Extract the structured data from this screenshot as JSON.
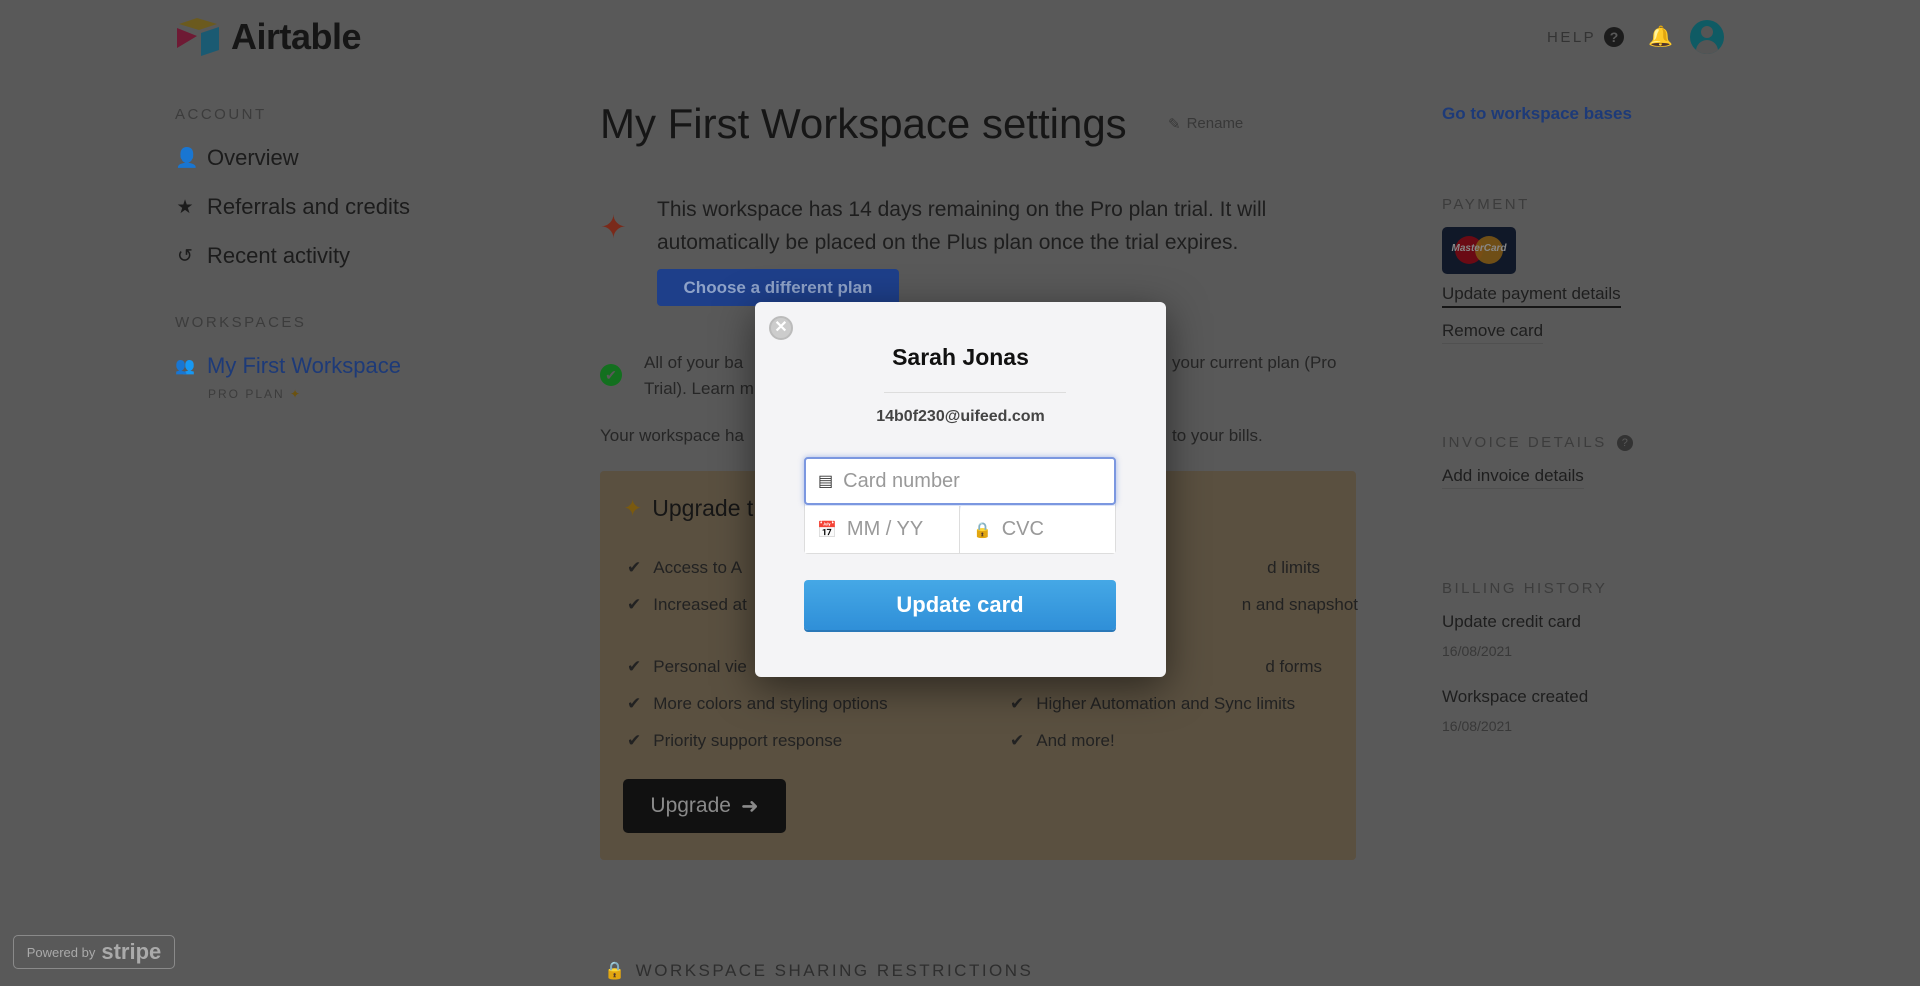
{
  "header": {
    "logo": "Airtable",
    "help": "HELP",
    "icons": [
      "help-icon",
      "bell-icon",
      "avatar-icon"
    ]
  },
  "sidebar": {
    "account_heading": "ACCOUNT",
    "items": [
      {
        "label": "Overview",
        "icon": "user-icon"
      },
      {
        "label": "Referrals and credits",
        "icon": "star-icon"
      },
      {
        "label": "Recent activity",
        "icon": "history-icon"
      }
    ],
    "workspaces_heading": "WORKSPACES",
    "workspace": {
      "label": "My First Workspace",
      "plan": "PRO PLAN"
    }
  },
  "main": {
    "title": "My First Workspace settings",
    "rename": "Rename",
    "trial_notice": [
      "This workspace has 14 days remaining on the Pro plan trial. It will",
      "automatically be placed on the Plus plan once the trial expires."
    ],
    "choose_plan": "Choose a different plan",
    "bases_left": [
      "All of your ba",
      "Trial). Learn m"
    ],
    "bases_right": "your current plan (Pro",
    "workspace_left": "Your workspace ha",
    "workspace_right": "to your bills.",
    "upgrade": {
      "title": "Upgrade t",
      "features_left": [
        "Access to A",
        "Increased at",
        "Personal vie",
        "More colors and styling options",
        "Priority support response"
      ],
      "features_right": [
        "d limits",
        "n and snapshot",
        "d forms",
        "Higher Automation and Sync limits",
        "And more!"
      ],
      "button": "Upgrade",
      "color": "#fbe8bd"
    },
    "sharing_heading": "WORKSPACE SHARING RESTRICTIONS"
  },
  "right": {
    "go_to_bases": "Go to workspace bases",
    "payment_heading": "PAYMENT",
    "card_brand": "MasterCard",
    "update_payment": "Update payment details",
    "remove_card": "Remove card",
    "invoice_heading": "INVOICE DETAILS",
    "add_invoice": "Add invoice details",
    "billing_heading": "BILLING HISTORY",
    "history": [
      {
        "label": "Update credit card",
        "date": "16/08/2021"
      },
      {
        "label": "Workspace created",
        "date": "16/08/2021"
      }
    ]
  },
  "modal": {
    "name": "Sarah Jonas",
    "email": "14b0f230@uifeed.com",
    "card_placeholder": "Card number",
    "expiry_placeholder": "MM / YY",
    "cvc_placeholder": "CVC",
    "submit": "Update card",
    "accent": "#3a9ee0"
  },
  "footer": {
    "powered_by": "Powered by",
    "stripe": "stripe"
  }
}
